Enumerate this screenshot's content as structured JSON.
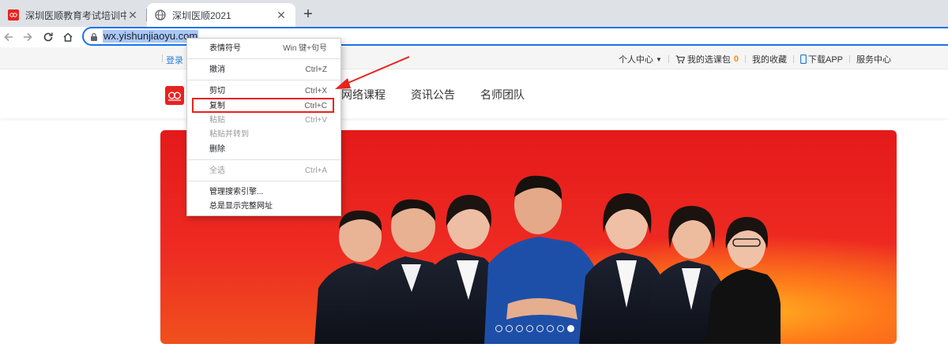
{
  "browser": {
    "tabs": [
      {
        "title": "深圳医顺教育考试培训中心官网",
        "active": false
      },
      {
        "title": "深圳医顺2021",
        "active": true
      }
    ],
    "url": "wx.yishunjiaoyu.com"
  },
  "site": {
    "topbar": {
      "login": "登录",
      "links": {
        "personal": "个人中心",
        "cart": "我的选课包",
        "cart_count": "0",
        "favorites": "我的收藏",
        "download": "下载APP",
        "service": "服务中心"
      }
    },
    "nav": [
      "网络课程",
      "资讯公告",
      "名师团队"
    ],
    "banner": {
      "slides": 8,
      "active_slide": 8
    }
  },
  "context_menu": {
    "items": [
      {
        "label": "表情符号",
        "shortcut": "Win 键+句号",
        "disabled": false
      },
      {
        "label": "撤消",
        "shortcut": "Ctrl+Z",
        "disabled": false
      },
      {
        "label": "剪切",
        "shortcut": "Ctrl+X",
        "disabled": false
      },
      {
        "label": "复制",
        "shortcut": "Ctrl+C",
        "disabled": false,
        "highlighted": true
      },
      {
        "label": "粘贴",
        "shortcut": "Ctrl+V",
        "disabled": true
      },
      {
        "label": "粘贴并转到",
        "shortcut": "",
        "disabled": true
      },
      {
        "label": "删除",
        "shortcut": "",
        "disabled": false
      },
      {
        "label": "全选",
        "shortcut": "Ctrl+A",
        "disabled": true
      },
      {
        "label": "管理搜索引擎...",
        "shortcut": "",
        "disabled": false
      },
      {
        "label": "总是显示完整网址",
        "shortcut": "",
        "disabled": false
      }
    ]
  },
  "colors": {
    "accent": "#1a73e8",
    "brand_red": "#e8231f",
    "link_blue": "#2a7fd4",
    "count_orange": "#ff8a00"
  }
}
